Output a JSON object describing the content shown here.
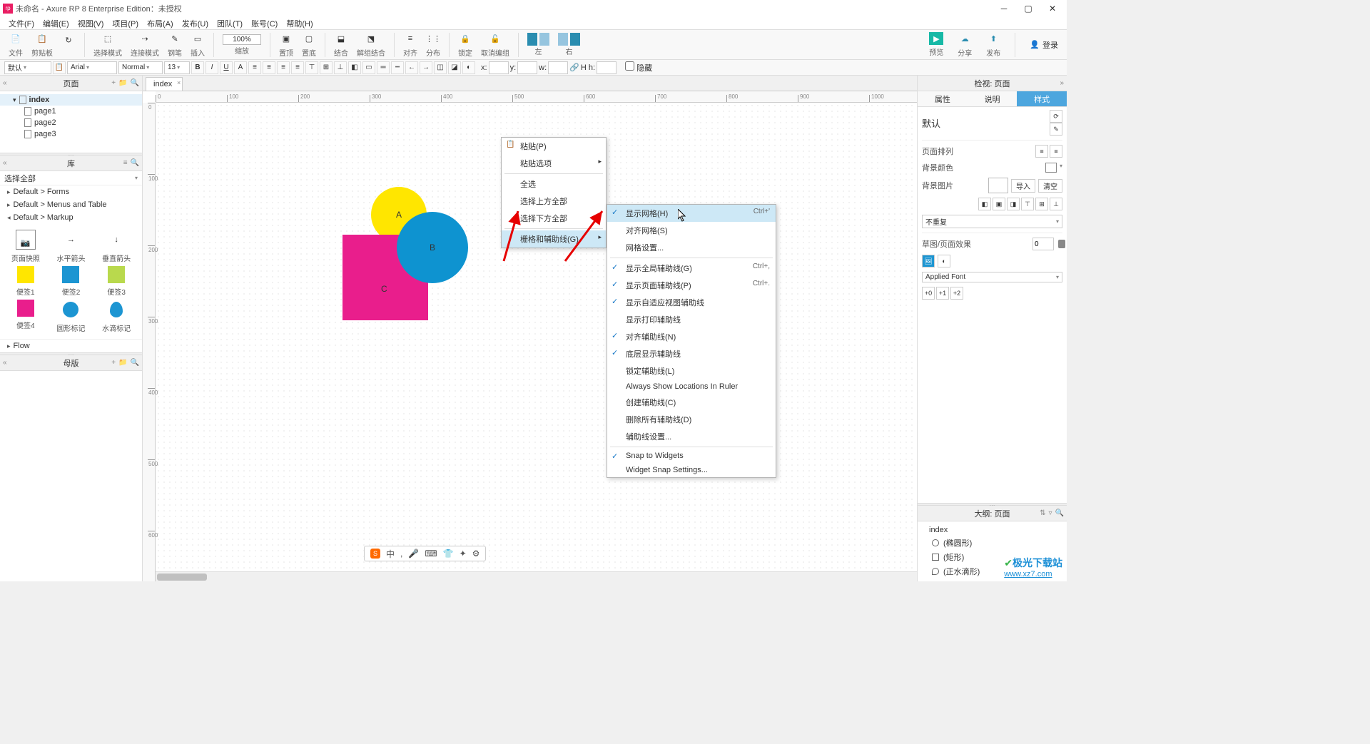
{
  "title": "未命名 - Axure RP 8 Enterprise Edition：未授权",
  "menu": [
    "文件(F)",
    "编辑(E)",
    "视图(V)",
    "项目(P)",
    "布局(A)",
    "发布(U)",
    "团队(T)",
    "账号(C)",
    "帮助(H)"
  ],
  "toolbar": {
    "groups": [
      {
        "icon": "file",
        "label": "文件"
      },
      {
        "icon": "paste",
        "label": "剪贴板"
      }
    ],
    "select_label": "选择模式",
    "connect_label": "连接模式",
    "pen_label": "钢笔",
    "insert_label": "插入",
    "zoom": "100%",
    "zoom_label": "缩放",
    "top_label": "置顶",
    "bottom_label": "置底",
    "group_label": "结合",
    "ungroup_label": "解组结合",
    "align_label": "对齐",
    "dist_label": "分布",
    "lock_label": "锁定",
    "undo_label": "取消编组",
    "left_label": "左",
    "right_label": "右",
    "preview_label": "预览",
    "share_label": "分享",
    "publish_label": "发布",
    "login_label": "登录"
  },
  "fmt": {
    "style": "默认",
    "font": "Arial",
    "weight": "Normal",
    "size": "13",
    "x": "x:",
    "y": "y:",
    "w": "w:",
    "h": "H h:",
    "hide": "隐藏"
  },
  "pages": {
    "title": "页面",
    "items": [
      "index",
      "page1",
      "page2",
      "page3"
    ]
  },
  "lib": {
    "title": "库",
    "select": "选择全部",
    "cats": [
      "Default > Forms",
      "Default > Menus and Table",
      "Default > Markup",
      "Flow"
    ],
    "cells": [
      "页面快照",
      "水平箭头",
      "垂直箭头",
      "便签1",
      "便签2",
      "便签3",
      "便签4",
      "圆形标记",
      "水滴标记"
    ]
  },
  "masters": {
    "title": "母版"
  },
  "tab": "index",
  "shapes": {
    "a": "A",
    "b": "B",
    "c": "C"
  },
  "ctx1": {
    "paste": "粘贴(P)",
    "paste_opts": "粘贴选项",
    "select_all": "全选",
    "select_above": "选择上方全部",
    "select_below": "选择下方全部",
    "grid": "栅格和辅助线(G)"
  },
  "ctx2": {
    "show_grid": {
      "label": "显示网格(H)",
      "sc": "Ctrl+'"
    },
    "snap_grid": "对齐网格(S)",
    "grid_settings": "网格设置...",
    "show_global": {
      "label": "显示全局辅助线(G)",
      "sc": "Ctrl+,"
    },
    "show_page": {
      "label": "显示页面辅助线(P)",
      "sc": "Ctrl+."
    },
    "show_adaptive": "显示自适应视图辅助线",
    "show_print": "显示打印辅助线",
    "snap_guides": "对齐辅助线(N)",
    "back_guides": "底层显示辅助线",
    "lock_guides": "锁定辅助线(L)",
    "always_show": "Always Show Locations In Ruler",
    "create_guides": "创建辅助线(C)",
    "delete_guides": "删除所有辅助线(D)",
    "guide_settings": "辅助线设置...",
    "snap_widgets": "Snap to Widgets",
    "widget_snap": "Widget Snap Settings..."
  },
  "right": {
    "panel_title": "检视: 页面",
    "tabs": [
      "属性",
      "说明",
      "样式"
    ],
    "default": "默认",
    "page_align": "页面排列",
    "bg_color": "背景颜色",
    "bg_image": "背景图片",
    "import": "导入",
    "clear": "清空",
    "no_repeat": "不重复",
    "sketch": "草图/页面效果",
    "sketch_val": "0",
    "applied_font": "Applied Font",
    "font_adj": [
      "+0",
      "+1",
      "+2"
    ],
    "outline": {
      "title": "大纲: 页面",
      "root": "index",
      "items": [
        "(椭圆形)",
        "(矩形)",
        "(正水滴形)"
      ]
    }
  },
  "ime": [
    "中",
    ",",
    "●",
    "⌨",
    "👕",
    "✦",
    "⚙"
  ],
  "watermark": {
    "brand": "极光下载站",
    "url": "www.xz7.com"
  }
}
